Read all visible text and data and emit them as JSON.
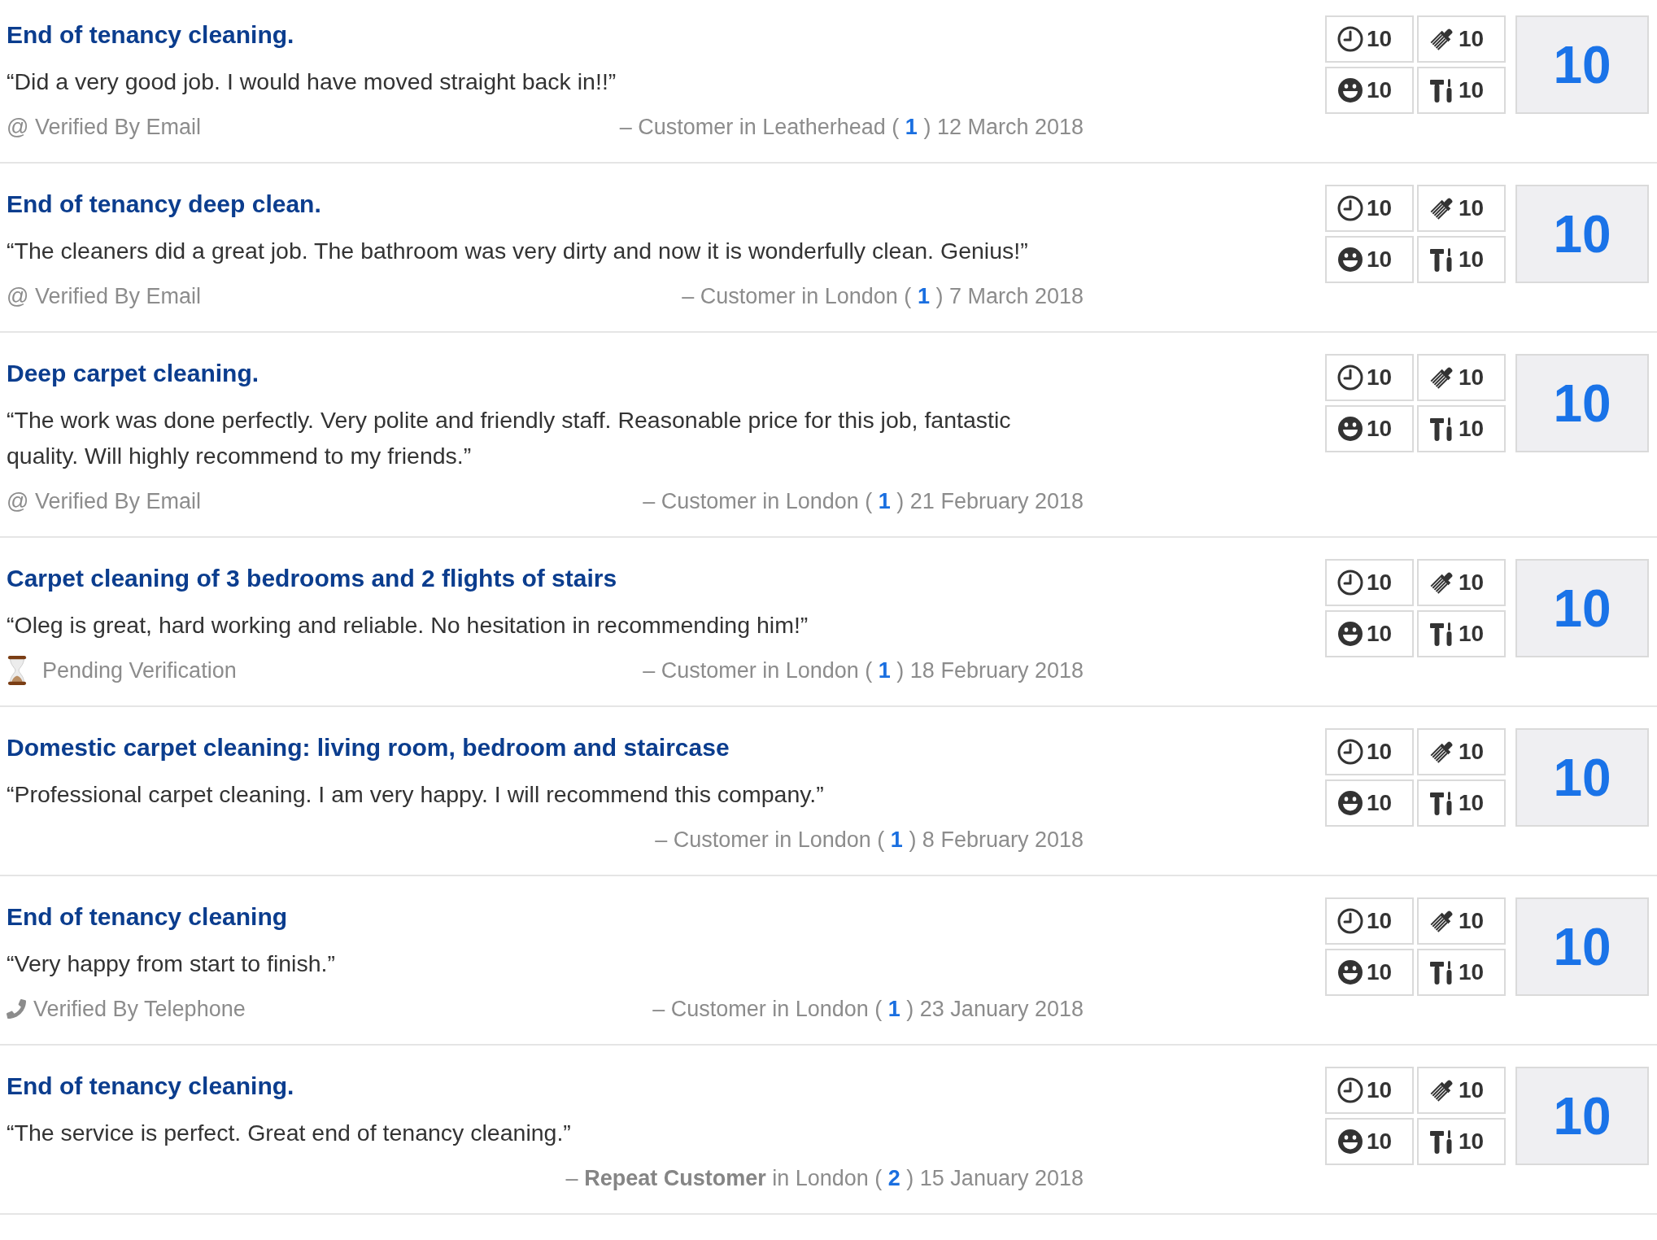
{
  "reviews": [
    {
      "title": "End of tenancy cleaning.",
      "quote": "“Did a very good job. I would have moved straight back in!!”",
      "verification": {
        "kind": "email",
        "label": "@ Verified By Email"
      },
      "reviewer": {
        "prefix": "– Customer in Leatherhead ( ",
        "count": "1",
        "suffix": " ) 12 March 2018"
      },
      "scores": [
        {
          "kind": "clock",
          "value": "10"
        },
        {
          "kind": "brush",
          "value": "10"
        },
        {
          "kind": "smiley",
          "value": "10"
        },
        {
          "kind": "tools",
          "value": "10"
        }
      ],
      "overall": "10"
    },
    {
      "title": "End of tenancy deep clean.",
      "quote": "“The cleaners did a great job. The bathroom was very dirty and now it is wonderfully clean. Genius!”",
      "verification": {
        "kind": "email",
        "label": "@ Verified By Email"
      },
      "reviewer": {
        "prefix": "– Customer in London ( ",
        "count": "1",
        "suffix": " ) 7 March 2018"
      },
      "scores": [
        {
          "kind": "clock",
          "value": "10"
        },
        {
          "kind": "brush",
          "value": "10"
        },
        {
          "kind": "smiley",
          "value": "10"
        },
        {
          "kind": "tools",
          "value": "10"
        }
      ],
      "overall": "10"
    },
    {
      "title": "Deep carpet cleaning.",
      "quote": "“The work was done perfectly. Very polite and friendly staff. Reasonable price for this job, fantastic quality. Will highly recommend to my friends.”",
      "verification": {
        "kind": "email",
        "label": "@ Verified By Email"
      },
      "reviewer": {
        "prefix": "– Customer in London ( ",
        "count": "1",
        "suffix": " ) 21 February 2018"
      },
      "scores": [
        {
          "kind": "clock",
          "value": "10"
        },
        {
          "kind": "brush",
          "value": "10"
        },
        {
          "kind": "smiley",
          "value": "10"
        },
        {
          "kind": "tools",
          "value": "10"
        }
      ],
      "overall": "10"
    },
    {
      "title": "Carpet cleaning of 3 bedrooms and 2 flights of stairs",
      "quote": "“Oleg is great, hard working and reliable. No hesitation in recommending him!”",
      "verification": {
        "kind": "pending",
        "label": "Pending Verification"
      },
      "reviewer": {
        "prefix": "– Customer in London ( ",
        "count": "1",
        "suffix": " ) 18 February 2018"
      },
      "scores": [
        {
          "kind": "clock",
          "value": "10"
        },
        {
          "kind": "brush",
          "value": "10"
        },
        {
          "kind": "smiley",
          "value": "10"
        },
        {
          "kind": "tools",
          "value": "10"
        }
      ],
      "overall": "10"
    },
    {
      "title": "Domestic carpet cleaning: living room, bedroom and staircase",
      "quote": "“Professional carpet cleaning. I am very happy. I will recommend this company.”",
      "reviewer": {
        "prefix": "– Customer in London ( ",
        "count": "1",
        "suffix": " ) 8 February 2018"
      },
      "scores": [
        {
          "kind": "clock",
          "value": "10"
        },
        {
          "kind": "brush",
          "value": "10"
        },
        {
          "kind": "smiley",
          "value": "10"
        },
        {
          "kind": "tools",
          "value": "10"
        }
      ],
      "overall": "10"
    },
    {
      "title": "End of tenancy cleaning",
      "quote": "“Very happy from start to finish.”",
      "verification": {
        "kind": "telephone",
        "label": "Verified By Telephone"
      },
      "reviewer": {
        "prefix": "– Customer in London ( ",
        "count": "1",
        "suffix": " ) 23 January 2018"
      },
      "scores": [
        {
          "kind": "clock",
          "value": "10"
        },
        {
          "kind": "brush",
          "value": "10"
        },
        {
          "kind": "smiley",
          "value": "10"
        },
        {
          "kind": "tools",
          "value": "10"
        }
      ],
      "overall": "10"
    },
    {
      "title": "End of tenancy cleaning.",
      "quote": "“The service is perfect. Great end of tenancy cleaning.”",
      "reviewer": {
        "prefix": "– **Repeat Customer** in London ( ",
        "count": "2",
        "suffix": " ) 15 January 2018"
      },
      "scores": [
        {
          "kind": "clock",
          "value": "10"
        },
        {
          "kind": "brush",
          "value": "10"
        },
        {
          "kind": "smiley",
          "value": "10"
        },
        {
          "kind": "tools",
          "value": "10"
        }
      ],
      "overall": "10"
    }
  ]
}
